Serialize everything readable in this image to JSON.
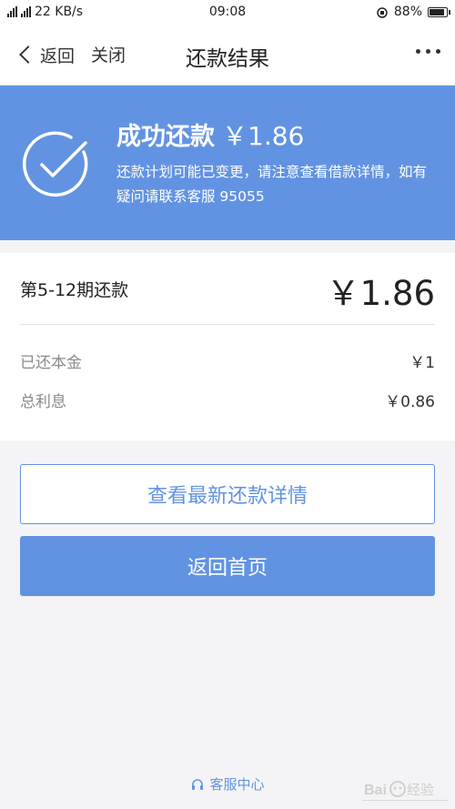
{
  "status_bar": {
    "network": "22 KB/s",
    "time": "09:08",
    "battery": "88%"
  },
  "nav": {
    "back_label": "返回",
    "close_label": "关闭",
    "title": "还款结果"
  },
  "banner": {
    "title": "成功还款",
    "amount": "￥1.86",
    "description": "还款计划可能已变更，请注意查看借款详情，如有疑问请联系客服 95055"
  },
  "details": {
    "period_label": "第5-12期还款",
    "period_amount": "￥1.86",
    "rows": [
      {
        "label": "已还本金",
        "value": "￥1"
      },
      {
        "label": "总利息",
        "value": "￥0.86"
      }
    ]
  },
  "buttons": {
    "view_details": "查看最新还款详情",
    "home": "返回首页"
  },
  "footer": {
    "service_label": "客服中心"
  },
  "watermark_text": "Baidu 经验",
  "colors": {
    "accent": "#6293e2",
    "background": "#f4f4f6"
  },
  "icons": [
    "chevron-left-icon",
    "more-icon",
    "check-circle-icon",
    "headset-icon",
    "battery-icon",
    "alarm-icon",
    "signal-icon"
  ]
}
